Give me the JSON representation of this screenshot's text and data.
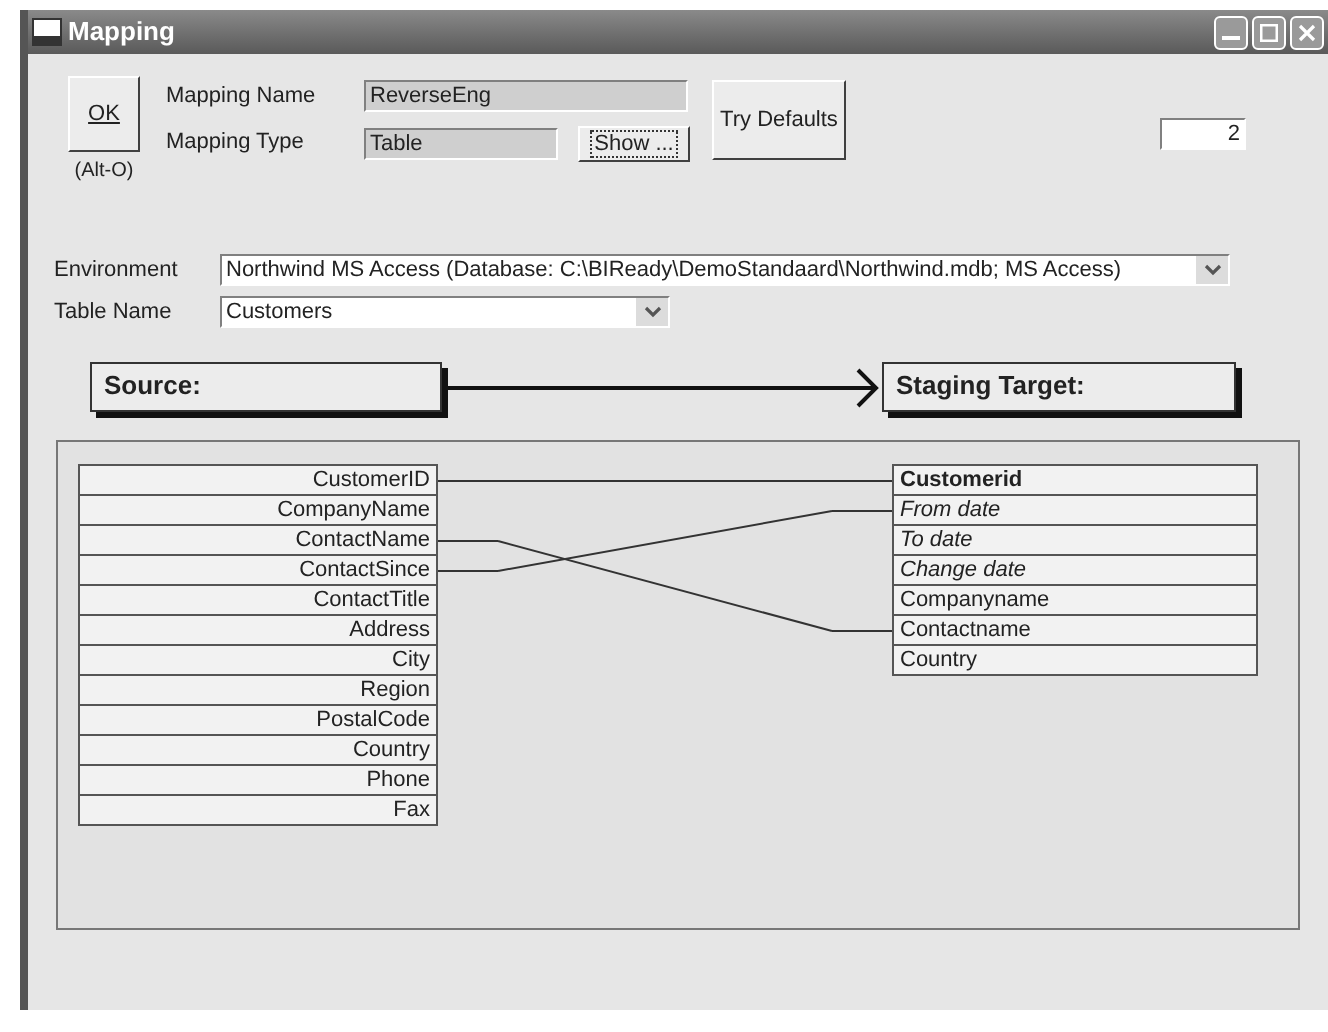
{
  "window": {
    "title": "Mapping"
  },
  "ok_button": {
    "label": "OK",
    "shortcut": "(Alt-O)"
  },
  "mapping_name": {
    "label": "Mapping Name",
    "value": "ReverseEng"
  },
  "mapping_type": {
    "label": "Mapping Type",
    "value": "Table",
    "button": "Show ..."
  },
  "try_defaults_button": {
    "label": "Try Defaults"
  },
  "counter_field": {
    "value": "2"
  },
  "environment": {
    "label": "Environment",
    "value": "Northwind MS Access (Database: C:\\BIReady\\DemoStandaard\\Northwind.mdb;  MS Access)"
  },
  "table_name": {
    "label": "Table Name",
    "value": "Customers"
  },
  "source_header": "Source:",
  "target_header": "Staging Target:",
  "source_fields": [
    {
      "name": "CustomerID",
      "mapped": true
    },
    {
      "name": "CompanyName",
      "mapped": false
    },
    {
      "name": "ContactName",
      "mapped": true
    },
    {
      "name": "ContactSince",
      "mapped": true
    },
    {
      "name": "ContactTitle",
      "mapped": false
    },
    {
      "name": "Address",
      "mapped": false
    },
    {
      "name": "City",
      "mapped": false
    },
    {
      "name": "Region",
      "mapped": false
    },
    {
      "name": "PostalCode",
      "mapped": false
    },
    {
      "name": "Country",
      "mapped": false
    },
    {
      "name": "Phone",
      "mapped": false
    },
    {
      "name": "Fax",
      "mapped": false
    }
  ],
  "target_fields": [
    {
      "name": "Customerid",
      "kind": "key",
      "mapped": true
    },
    {
      "name": "From date",
      "kind": "system",
      "mapped": true
    },
    {
      "name": "To date",
      "kind": "system",
      "mapped": false
    },
    {
      "name": "Change date",
      "kind": "system",
      "mapped": false
    },
    {
      "name": "Companyname",
      "kind": "normal",
      "mapped": false
    },
    {
      "name": "Contactname",
      "kind": "normal",
      "mapped": true
    },
    {
      "name": "Country",
      "kind": "normal",
      "mapped": false
    }
  ]
}
